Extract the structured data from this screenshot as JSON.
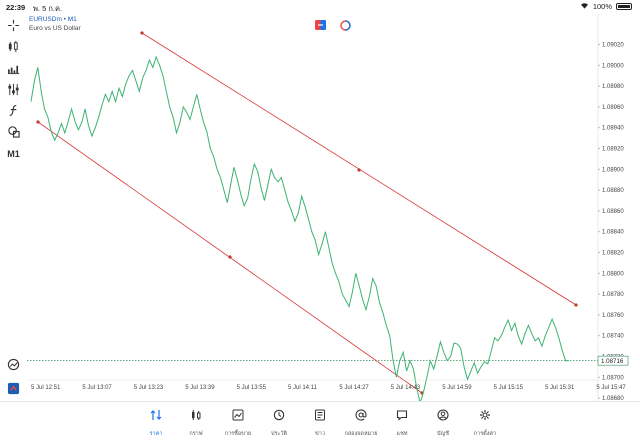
{
  "status_bar": {
    "time": "22:39",
    "date": "พ. 5 ก.ค.",
    "battery": "100%"
  },
  "symbol": {
    "name": "EURUSDm • M1",
    "description": "Euro vs US Dollar"
  },
  "toolbar": [
    "crosshair-icon",
    "candles-icon",
    "volumes-icon",
    "sliders-icon",
    "function-icon",
    "objects-icon"
  ],
  "timeframe": "M1",
  "price_axis": [
    "1.09020",
    "1.09000",
    "1.08980",
    "1.08960",
    "1.08940",
    "1.08920",
    "1.08900",
    "1.08880",
    "1.08860",
    "1.08840",
    "1.08820",
    "1.08800",
    "1.08780",
    "1.08760",
    "1.08740",
    "1.08720",
    "1.08700",
    "1.08680"
  ],
  "current_price": "1.08716",
  "time_axis": [
    "5 Jul 12:51",
    "5 Jul 13:07",
    "5 Jul 13:23",
    "5 Jul 13:39",
    "5 Jul 13:55",
    "5 Jul 14:11",
    "5 Jul 14:27",
    "5 Jul 14:43",
    "5 Jul 14:59",
    "5 Jul 15:15",
    "5 Jul 15:31",
    "5 Jul 15:47"
  ],
  "colors": {
    "line": "#3cb371",
    "trend": "#d93232",
    "accent": "#1a73e8",
    "bid": "#2e8b57"
  },
  "chart_data": {
    "type": "line",
    "xlabel": "",
    "ylabel": "",
    "ylim": [
      1.0867,
      1.0903
    ],
    "series": [
      {
        "values": [
          1.08965,
          1.08985,
          1.08998,
          1.08975,
          1.08958,
          1.0895,
          1.08936,
          1.08928,
          1.08935,
          1.08944,
          1.08935,
          1.08946,
          1.08958,
          1.08946,
          1.08938,
          1.08945,
          1.08958,
          1.08942,
          1.08932,
          1.0894,
          1.0895,
          1.08962,
          1.08972,
          1.08965,
          1.08975,
          1.08965,
          1.08978,
          1.0897,
          1.08982,
          1.0899,
          1.08995,
          1.08985,
          1.08975,
          1.08988,
          1.08995,
          1.09005,
          1.08998,
          1.09008,
          1.09,
          1.0899,
          1.08975,
          1.0896,
          1.0895,
          1.08935,
          1.08945,
          1.0896,
          1.08955,
          1.08948,
          1.0896,
          1.08972,
          1.08958,
          1.08945,
          1.08936,
          1.0892,
          1.08912,
          1.089,
          1.08892,
          1.0888,
          1.08868,
          1.08885,
          1.08902,
          1.0889,
          1.08876,
          1.08865,
          1.08872,
          1.0889,
          1.08905,
          1.08898,
          1.08882,
          1.0887,
          1.08885,
          1.089,
          1.08892,
          1.08888,
          1.08892,
          1.0888,
          1.08868,
          1.0886,
          1.0885,
          1.08858,
          1.08874,
          1.08864,
          1.08852,
          1.0884,
          1.08832,
          1.08818,
          1.08828,
          1.0884,
          1.08825,
          1.0881,
          1.088,
          1.08792,
          1.0878,
          1.08774,
          1.08768,
          1.08782,
          1.088,
          1.08788,
          1.08775,
          1.08765,
          1.08778,
          1.08795,
          1.08788,
          1.08772,
          1.08762,
          1.0875,
          1.0874,
          1.08716,
          1.087,
          1.08716,
          1.08724,
          1.08706,
          1.08716,
          1.08708,
          1.0869,
          1.08675,
          1.08686,
          1.087,
          1.08716,
          1.08708,
          1.0872,
          1.08734,
          1.08724,
          1.08716,
          1.0872,
          1.08733,
          1.08732,
          1.08728,
          1.0871,
          1.08698,
          1.08706,
          1.08714,
          1.08704,
          1.0871,
          1.08715,
          1.08713,
          1.08725,
          1.08738,
          1.08735,
          1.0874,
          1.08748,
          1.08755,
          1.08745,
          1.08752,
          1.0874,
          1.08732,
          1.08742,
          1.0875,
          1.08742,
          1.08735,
          1.08738,
          1.0873,
          1.0874,
          1.08748,
          1.08756,
          1.08748,
          1.08738,
          1.08726,
          1.08716,
          1.08716
        ]
      }
    ]
  },
  "nav": [
    {
      "label": "ราคา",
      "icon": "quotes-icon",
      "active": true
    },
    {
      "label": "กราฟ",
      "icon": "chart-icon",
      "active": false
    },
    {
      "label": "การซื้อขาย",
      "icon": "trade-icon",
      "active": false
    },
    {
      "label": "ประวัติ",
      "icon": "history-icon",
      "active": false
    },
    {
      "label": "ข่าว",
      "icon": "news-icon",
      "active": false
    },
    {
      "label": "กล่องจดหมาย",
      "icon": "mailbox-icon",
      "active": false
    },
    {
      "label": "แชท",
      "icon": "chat-icon",
      "active": false
    },
    {
      "label": "บัญชี",
      "icon": "account-icon",
      "active": false
    },
    {
      "label": "การตั้งค่า",
      "icon": "settings-icon",
      "active": false
    }
  ]
}
